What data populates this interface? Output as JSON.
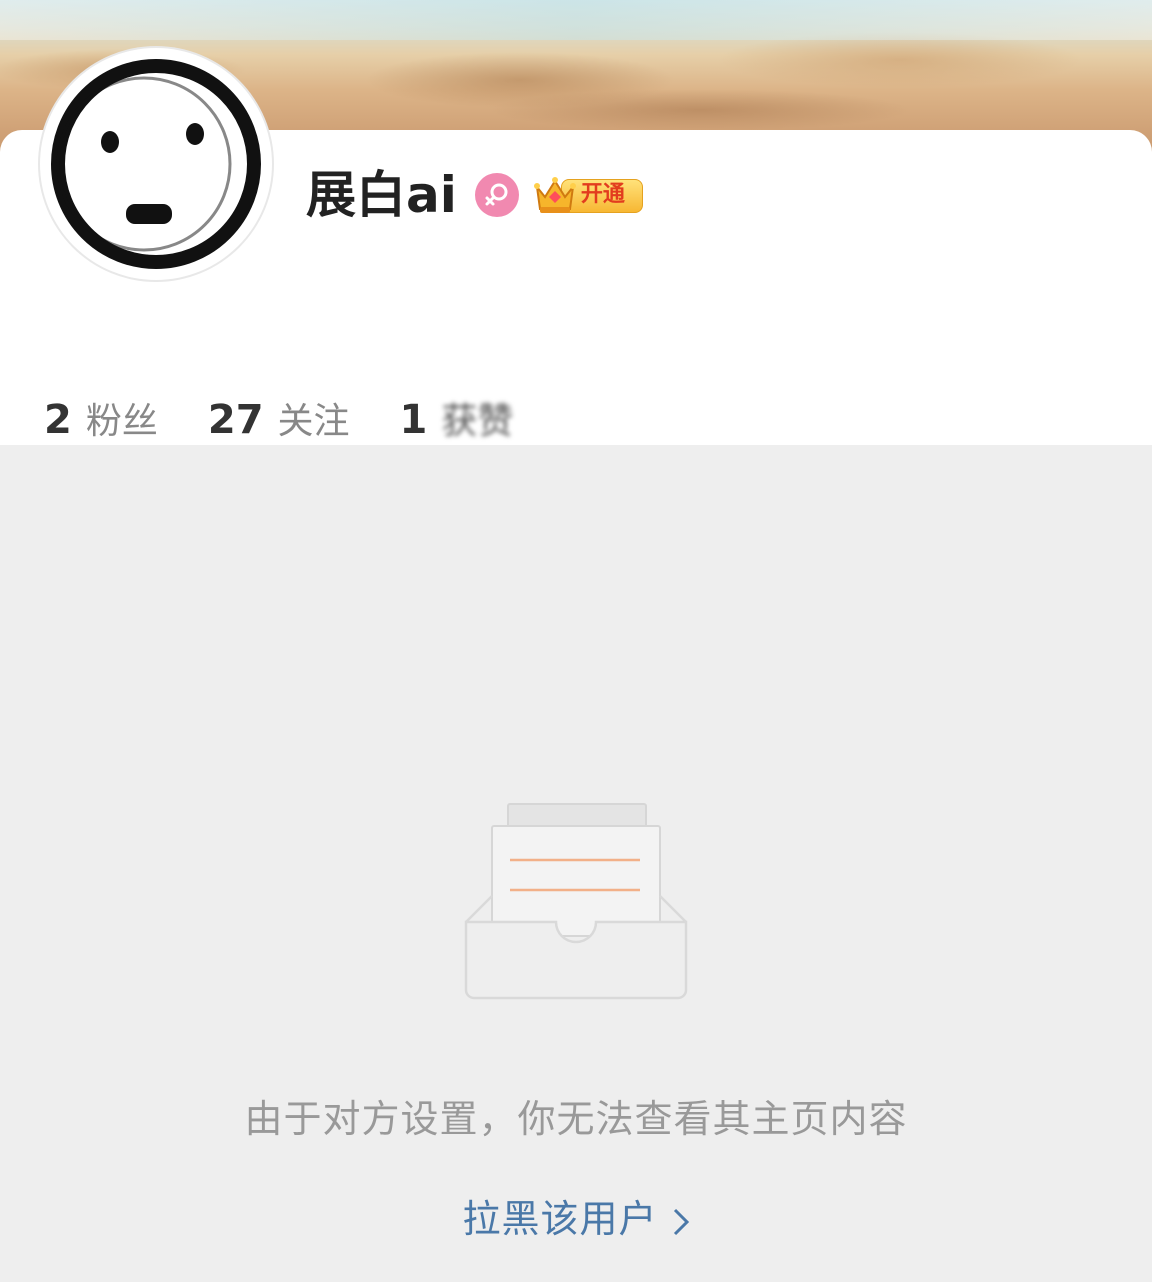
{
  "profile": {
    "username": "展白ai",
    "gender_icon": "female-icon",
    "gender_color": "#f189b0",
    "vip_badge_label": "开通",
    "vip_icon": "crown-icon"
  },
  "stats": [
    {
      "count": "2",
      "label": "粉丝"
    },
    {
      "count": "27",
      "label": "关注"
    },
    {
      "count": "1",
      "label": "获赞"
    }
  ],
  "empty_state": {
    "message": "由于对方设置，你无法查看其主页内容",
    "block_link_label": "拉黑该用户"
  },
  "colors": {
    "link": "#4a78a8",
    "muted_text": "#999999",
    "background": "#eeeeee"
  }
}
